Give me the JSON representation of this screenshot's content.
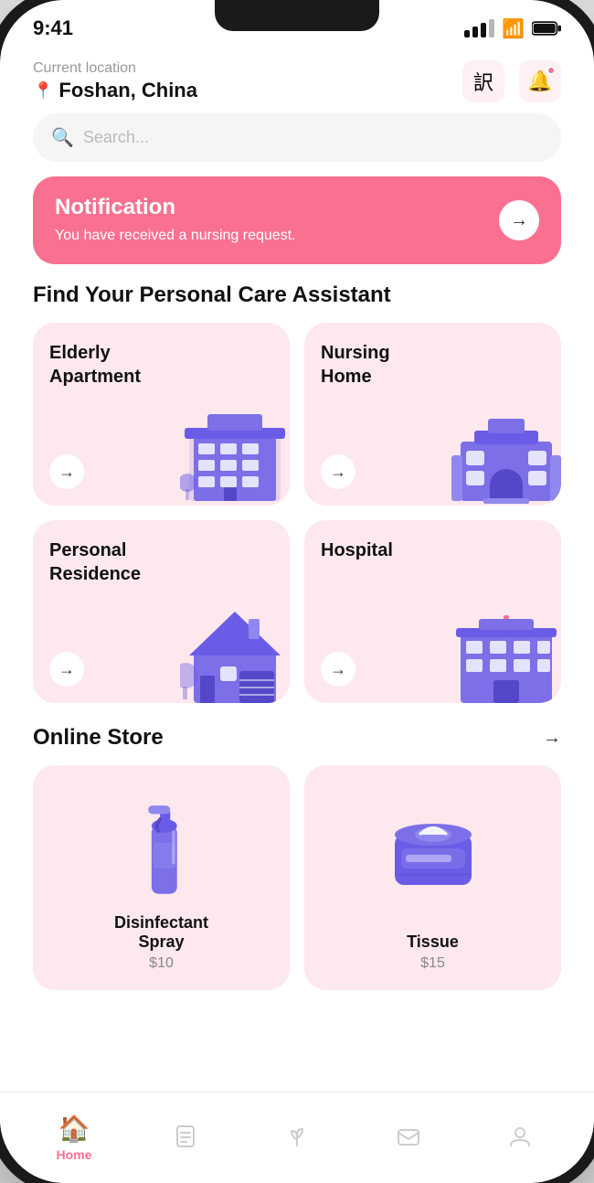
{
  "statusBar": {
    "time": "9:41"
  },
  "header": {
    "locationLabel": "Current location",
    "locationName": "Foshan, China",
    "translateIconLabel": "translate-icon",
    "bellIconLabel": "bell-icon"
  },
  "search": {
    "placeholder": "Search..."
  },
  "notification": {
    "title": "Notification",
    "message": "You have received a nursing request.",
    "arrowLabel": "→"
  },
  "careSection": {
    "title": "Find Your Personal Care Assistant",
    "cards": [
      {
        "id": "elderly-apartment",
        "title": "Elderly\nApartment"
      },
      {
        "id": "nursing-home",
        "title": "Nursing\nHome"
      },
      {
        "id": "personal-residence",
        "title": "Personal\nResidence"
      },
      {
        "id": "hospital",
        "title": "Hospital"
      }
    ]
  },
  "storeSection": {
    "title": "Online Store",
    "items": [
      {
        "id": "disinfectant-spray",
        "name": "Disinfectant\nSpray",
        "price": "$10"
      },
      {
        "id": "tissue",
        "name": "Tissue",
        "price": "$15"
      }
    ]
  },
  "bottomNav": {
    "items": [
      {
        "id": "home",
        "label": "Home",
        "active": true
      },
      {
        "id": "documents",
        "label": "",
        "active": false
      },
      {
        "id": "plant",
        "label": "",
        "active": false
      },
      {
        "id": "mail",
        "label": "",
        "active": false
      },
      {
        "id": "profile",
        "label": "",
        "active": false
      }
    ]
  }
}
